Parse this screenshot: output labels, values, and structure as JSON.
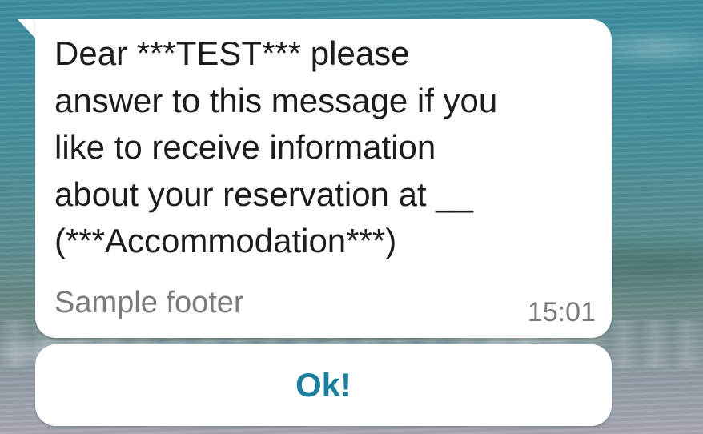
{
  "message": {
    "body": "Dear ***TEST*** please\nanswer to this message if you\nlike to receive information\nabout your reservation at __\n(***Accommodation***)",
    "footer": "Sample footer",
    "time": "15:01"
  },
  "quick_reply": {
    "label": "Ok!"
  },
  "colors": {
    "bubble": "#ffffff",
    "body_text": "#1c1c1c",
    "meta_text": "#7b7b7b",
    "button_text": "#1d7f9e"
  }
}
